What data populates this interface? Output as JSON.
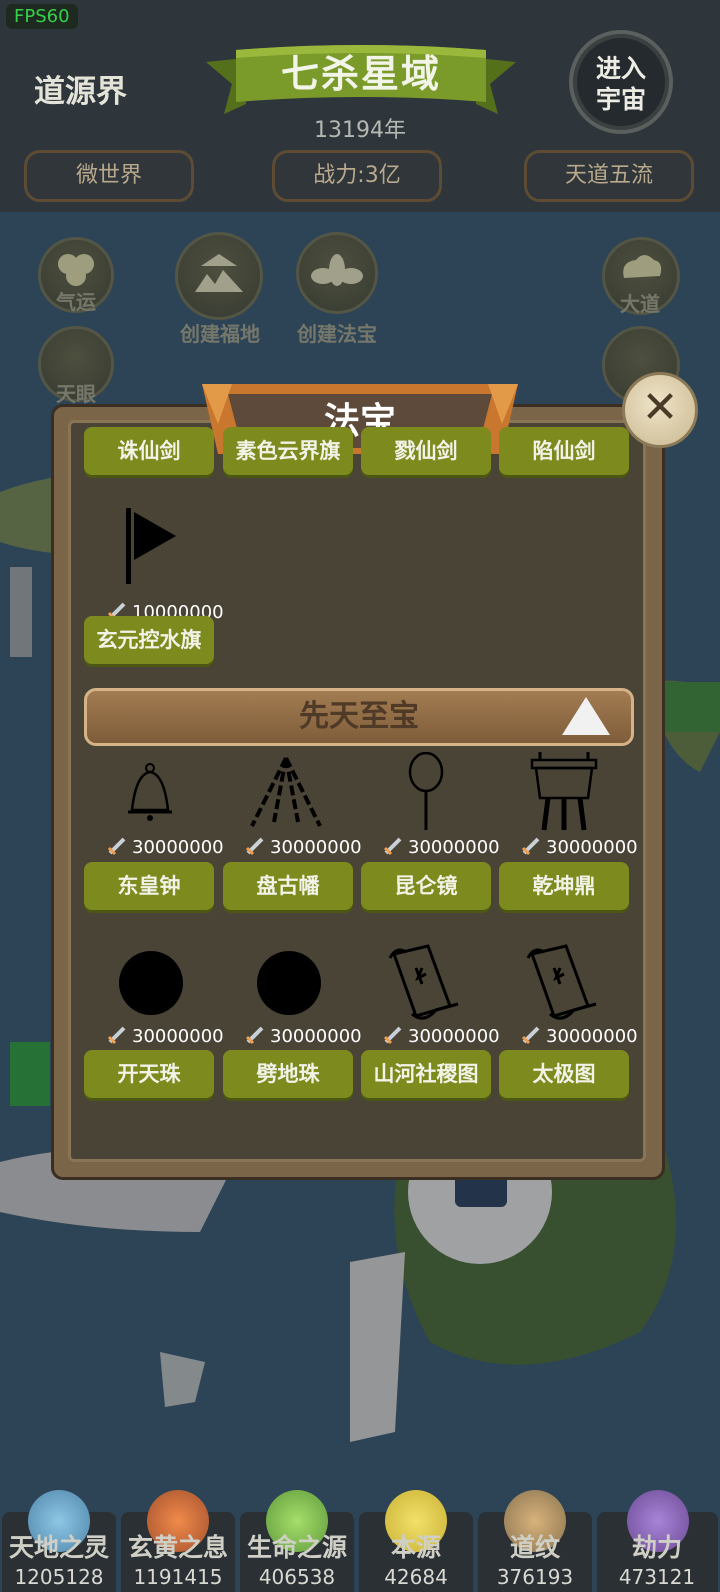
{
  "fps": "FPS60",
  "header": {
    "realm": "道源界",
    "star_domain": "七杀星域",
    "year": "13194年",
    "enter_universe": "进入\n宇宙",
    "tags": [
      "微世界",
      "战力:3亿",
      "天道五流"
    ]
  },
  "side_buttons": {
    "qiyun": "气运",
    "create_fudi": "创建福地",
    "create_fabao": "创建法宝",
    "dadao": "大道",
    "tianyan": "天眼"
  },
  "dialog": {
    "title": "法宝",
    "partial_row": [
      "诛仙剑",
      "素色云界旗",
      "戮仙剑",
      "陷仙剑"
    ],
    "single_item": {
      "name": "玄元控水旗",
      "cost": "10000000",
      "icon": "flag-icon"
    },
    "category": {
      "label": "先天至宝",
      "state": "expanded"
    },
    "items": [
      {
        "name": "东皇钟",
        "cost": "30000000",
        "icon": "bell-icon"
      },
      {
        "name": "盘古幡",
        "cost": "30000000",
        "icon": "banner-icon"
      },
      {
        "name": "昆仑镜",
        "cost": "30000000",
        "icon": "mirror-icon"
      },
      {
        "name": "乾坤鼎",
        "cost": "30000000",
        "icon": "cauldron-icon"
      },
      {
        "name": "开天珠",
        "cost": "30000000",
        "icon": "orb-icon"
      },
      {
        "name": "劈地珠",
        "cost": "30000000",
        "icon": "orb-icon"
      },
      {
        "name": "山河社稷图",
        "cost": "30000000",
        "icon": "scroll-icon"
      },
      {
        "name": "太极图",
        "cost": "30000000",
        "icon": "scroll-icon"
      }
    ]
  },
  "resources": [
    {
      "name": "天地之灵",
      "value": "1205128",
      "color": "#4f86a8"
    },
    {
      "name": "玄黄之息",
      "value": "1191415",
      "color": "#a4512e"
    },
    {
      "name": "生命之源",
      "value": "406538",
      "color": "#5f9a3c"
    },
    {
      "name": "本源",
      "value": "42684",
      "color": "#c9b234"
    },
    {
      "name": "道纹",
      "value": "376193",
      "color": "#8a7452"
    },
    {
      "name": "劫力",
      "value": "473121",
      "color": "#6c4b94"
    }
  ],
  "colors": {
    "button_green": "#7c8a1e",
    "panel_brown": "#7a6548",
    "ribbon_green": "#6b8a22"
  }
}
